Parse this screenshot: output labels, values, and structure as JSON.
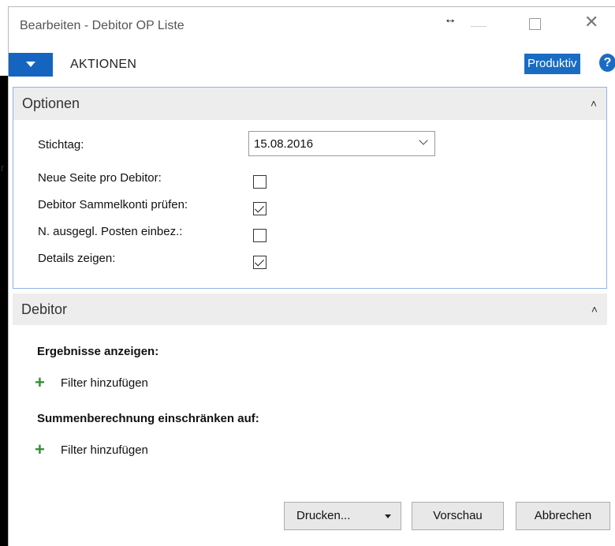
{
  "window": {
    "title": "Bearbeiten - Debitor OP Liste",
    "resize_symbol": "↔",
    "close_symbol": "✕"
  },
  "menubar": {
    "actions_label": "AKTIONEN",
    "environment_badge": "Produktiv",
    "help_symbol": "?",
    "accent_color": "#1565c0"
  },
  "options": {
    "title": "Optionen",
    "collapse_symbol": "˄",
    "fields": {
      "stichtag_label": "Stichtag:",
      "stichtag_value": "15.08.2016",
      "neue_seite_label": "Neue Seite pro Debitor:",
      "neue_seite_checked": false,
      "sammelkonti_label": "Debitor Sammelkonti prüfen:",
      "sammelkonti_checked": true,
      "ausgegl_label": "N. ausgegl. Posten einbez.:",
      "ausgegl_checked": false,
      "details_label": "Details zeigen:",
      "details_checked": true
    }
  },
  "debitor": {
    "title": "Debitor",
    "collapse_symbol": "˄",
    "results_label": "Ergebnisse anzeigen:",
    "filter_add_1": "Filter hinzufügen",
    "sum_label": "Summenberechnung einschränken auf:",
    "filter_add_2": "Filter hinzufügen",
    "plus_symbol": "+"
  },
  "buttons": {
    "print": "Drucken...",
    "preview": "Vorschau",
    "cancel": "Abbrechen"
  }
}
